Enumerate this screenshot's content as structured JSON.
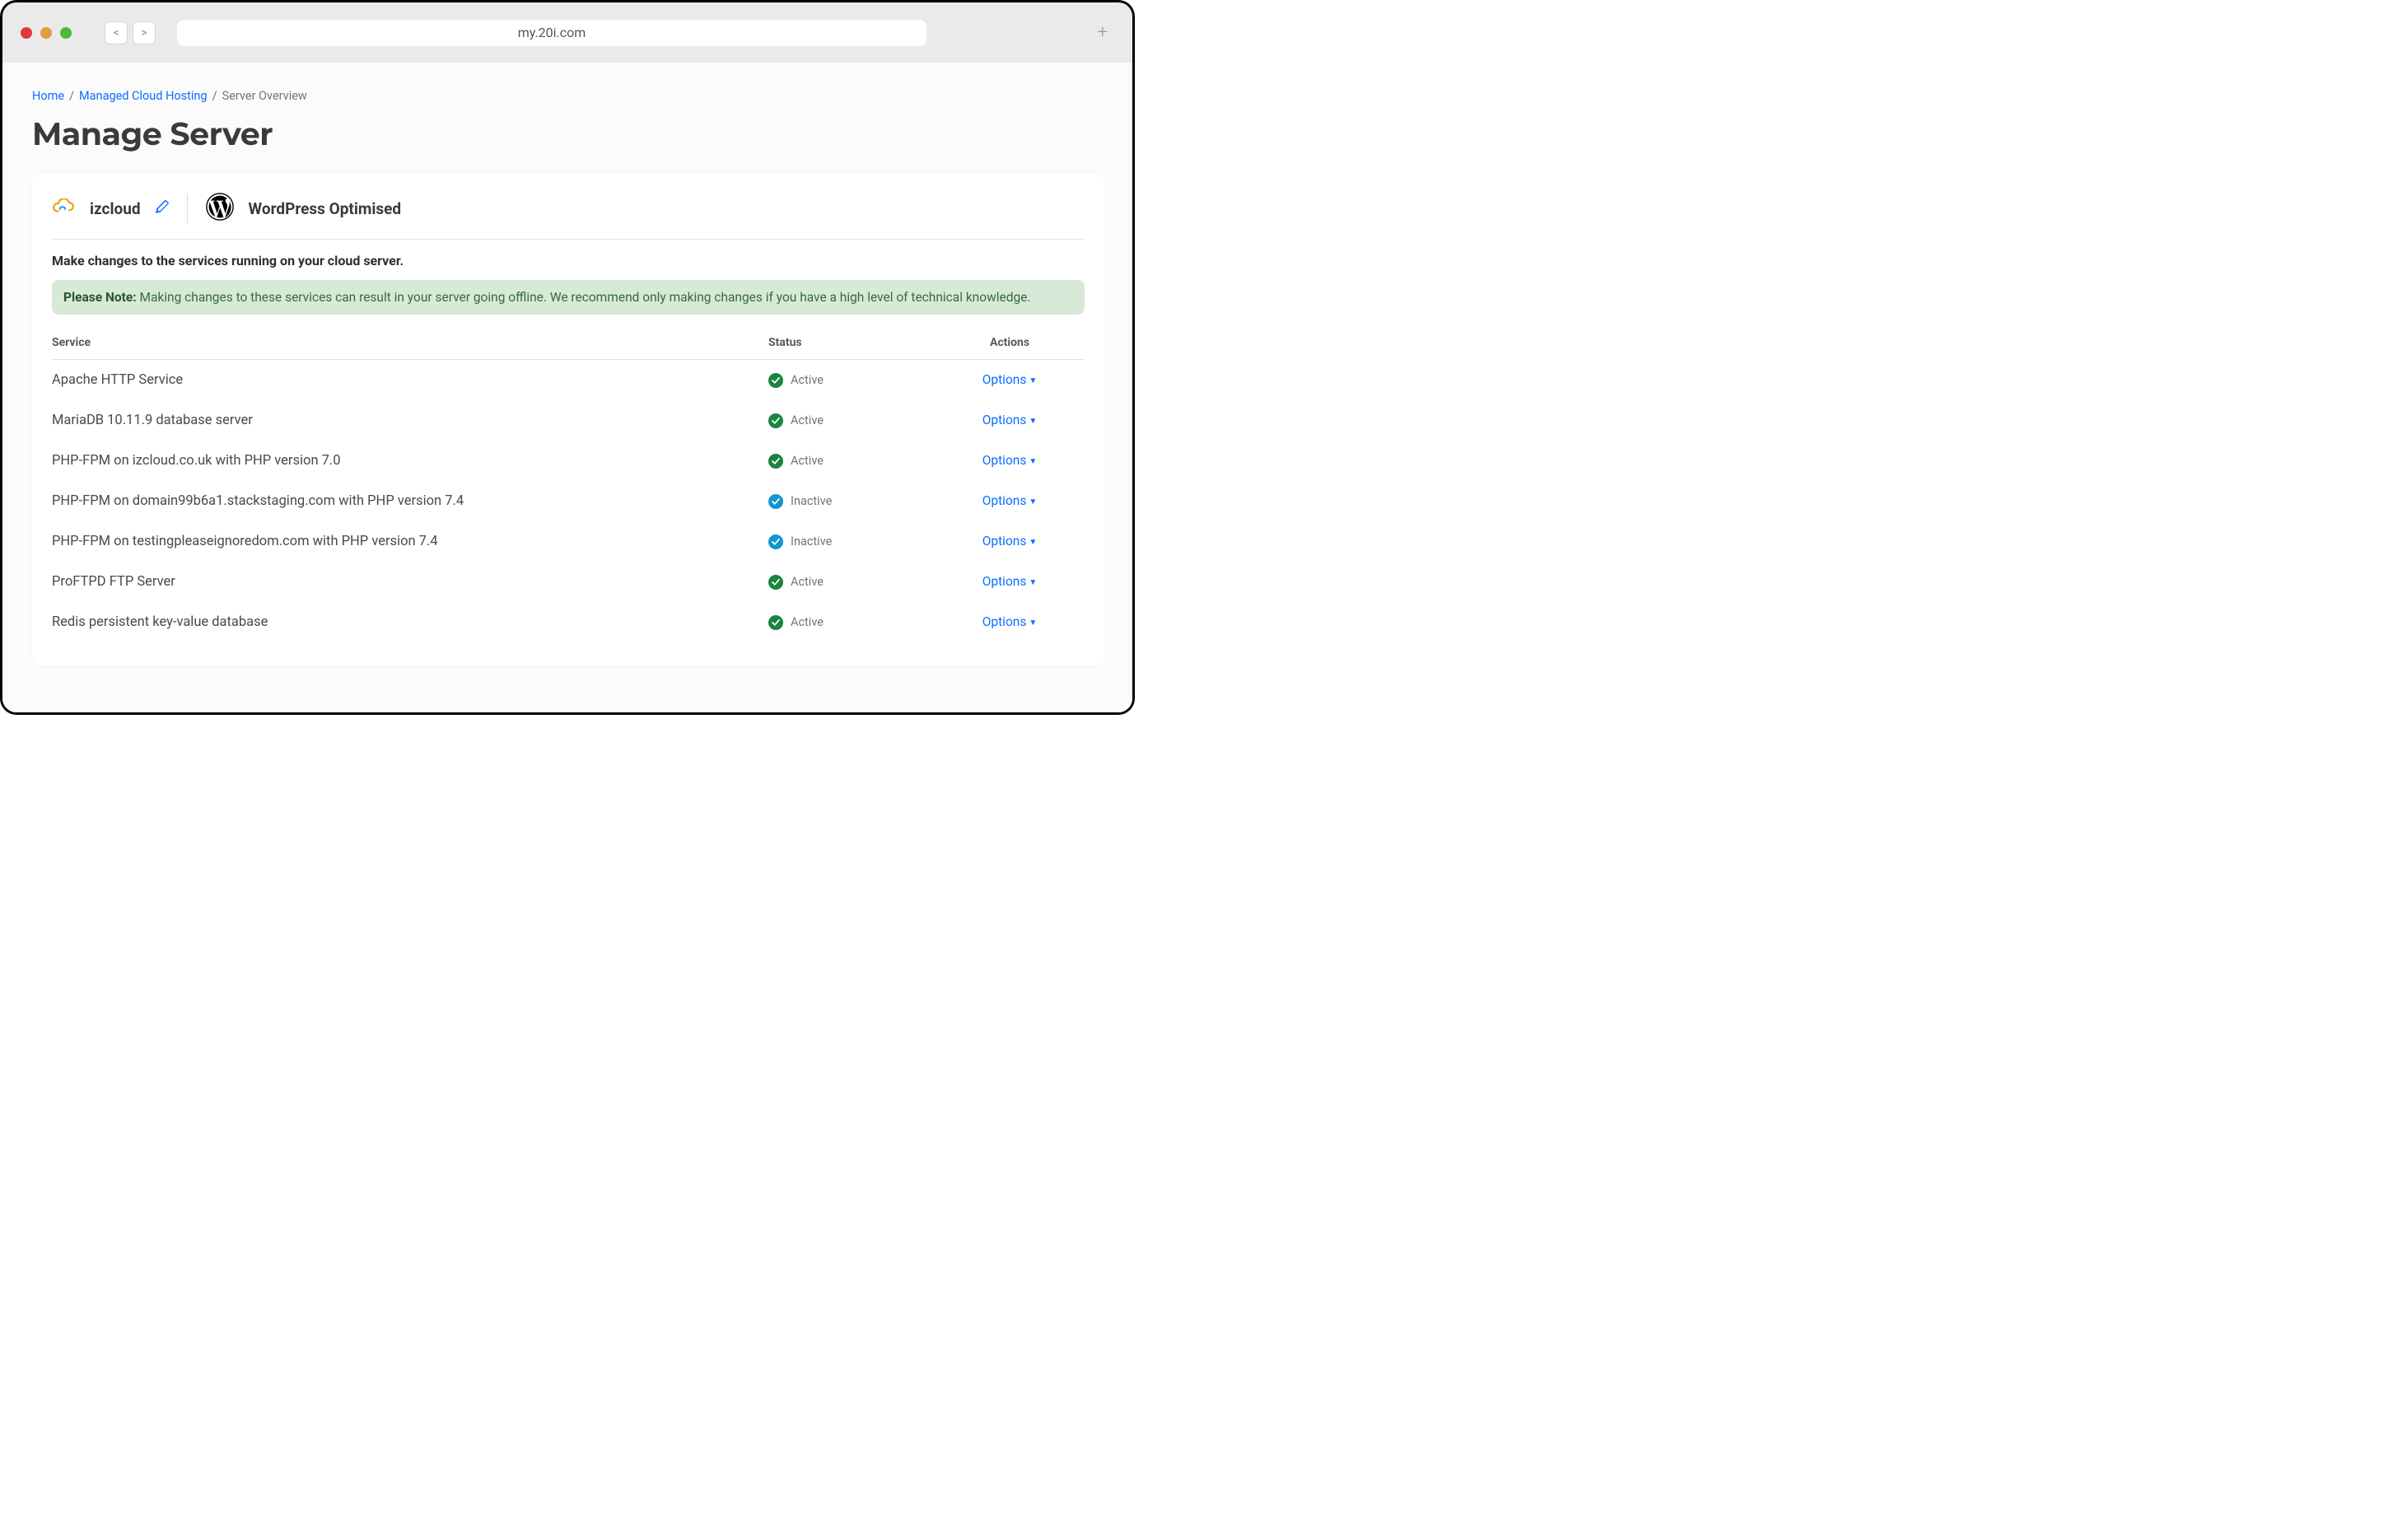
{
  "browser": {
    "url": "my.20i.com",
    "back_label": "<",
    "forward_label": ">",
    "plus_label": "+"
  },
  "breadcrumb": {
    "items": [
      {
        "label": "Home",
        "link": true
      },
      {
        "label": "Managed Cloud Hosting",
        "link": true
      },
      {
        "label": "Server Overview",
        "link": false
      }
    ]
  },
  "page": {
    "title": "Manage Server",
    "server_name": "izcloud",
    "plan_label": "WordPress Optimised",
    "subheading": "Make changes to the services running on your cloud server.",
    "note_prefix": "Please Note:",
    "note_body": " Making changes to these services can result in your server going offline. We recommend only making changes if you have a high level of technical knowledge."
  },
  "table": {
    "headers": {
      "service": "Service",
      "status": "Status",
      "actions": "Actions"
    },
    "options_label": "Options",
    "rows": [
      {
        "service": "Apache HTTP Service",
        "status": "Active",
        "active": true
      },
      {
        "service": "MariaDB 10.11.9 database server",
        "status": "Active",
        "active": true
      },
      {
        "service": "PHP-FPM on izcloud.co.uk with PHP version 7.0",
        "status": "Active",
        "active": true
      },
      {
        "service": "PHP-FPM on domain99b6a1.stackstaging.com with PHP version 7.4",
        "status": "Inactive",
        "active": false
      },
      {
        "service": "PHP-FPM on testingpleaseignoredom.com with PHP version 7.4",
        "status": "Inactive",
        "active": false
      },
      {
        "service": "ProFTPD FTP Server",
        "status": "Active",
        "active": true
      },
      {
        "service": "Redis persistent key-value database",
        "status": "Active",
        "active": true
      }
    ]
  }
}
